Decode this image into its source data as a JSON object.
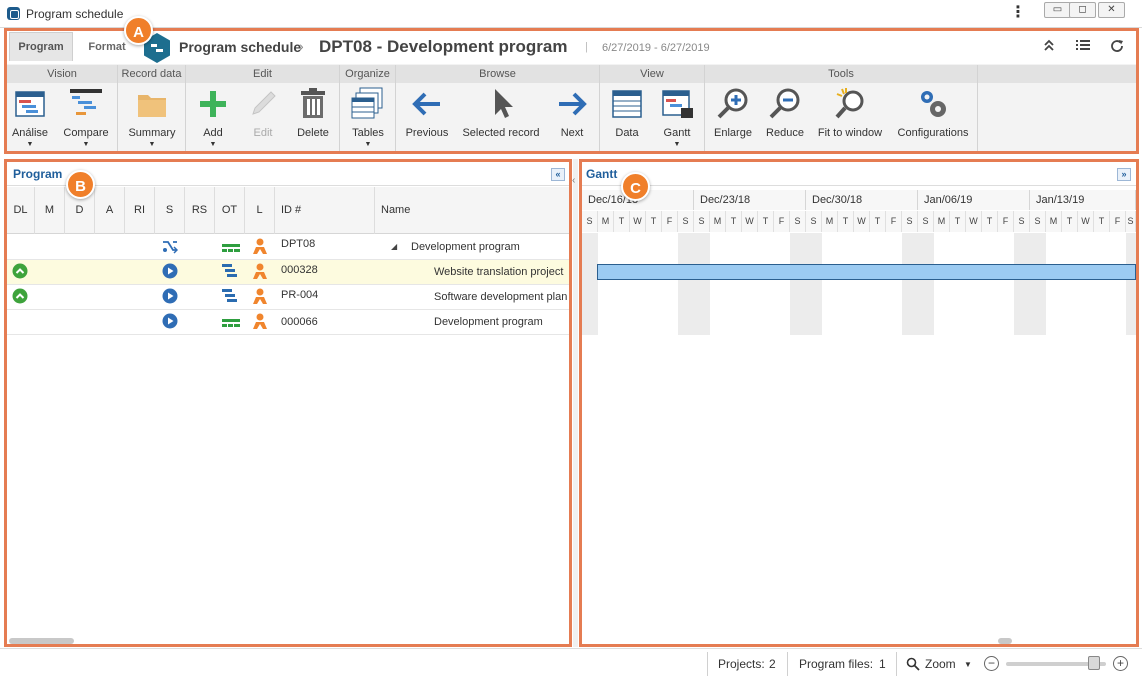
{
  "window": {
    "title": "Program schedule",
    "menu_icon": "kebab-icon",
    "controls": [
      "minimize-icon",
      "restore-icon",
      "close-icon"
    ]
  },
  "tabs": [
    {
      "label": "Program",
      "active": true
    },
    {
      "label": "Format",
      "active": false
    }
  ],
  "header": {
    "breadcrumb": "Program schedule",
    "separator": "›",
    "record_title": "DPT08 - Development program",
    "divider": "|",
    "date_range": "6/27/2019 - 6/27/2019",
    "icons": [
      "collapse-up-icon",
      "list-icon",
      "refresh-icon"
    ]
  },
  "ribbon": {
    "groups": {
      "vision": "Vision",
      "record_data": "Record data",
      "edit": "Edit",
      "organize": "Organize",
      "browse": "Browse",
      "view": "View",
      "tools": "Tools"
    },
    "buttons": {
      "analise": "Análise",
      "compare": "Compare",
      "summary": "Summary",
      "add": "Add",
      "edit": "Edit",
      "delete": "Delete",
      "tables": "Tables",
      "previous": "Previous",
      "selected_record": "Selected record",
      "next": "Next",
      "data": "Data",
      "gantt": "Gantt",
      "enlarge": "Enlarge",
      "reduce": "Reduce",
      "fit_to_window": "Fit to window",
      "configurations": "Configurations"
    }
  },
  "program_panel": {
    "title": "Program",
    "columns": [
      "DL",
      "M",
      "D",
      "A",
      "RI",
      "S",
      "RS",
      "OT",
      "L",
      "ID #",
      "Name"
    ],
    "rows": [
      {
        "dl": "",
        "s_icon": "shuffle-icon",
        "ot_color": "#2e9e3f",
        "id": "DPT08",
        "name": "Development program",
        "expand": "◢",
        "selected": false
      },
      {
        "dl": "up-circle-icon",
        "s_icon": "play-circle-icon",
        "ot_color": "#2b6cb0",
        "id": "000328",
        "name": "Website translation project",
        "selected": true
      },
      {
        "dl": "up-circle-icon",
        "s_icon": "play-circle-icon",
        "ot_color": "#2b6cb0",
        "id": "PR-004",
        "name": "Software development plan",
        "selected": false
      },
      {
        "dl": "",
        "s_icon": "play-circle-icon",
        "ot_color": "#2e9e3f",
        "id": "000066",
        "name": "Development program",
        "selected": false
      }
    ]
  },
  "gantt_panel": {
    "title": "Gantt",
    "weeks": [
      "Dec/16/18",
      "Dec/23/18",
      "Dec/30/18",
      "Jan/06/19",
      "Jan/13/19"
    ],
    "day_letters": [
      "S",
      "M",
      "T",
      "W",
      "T",
      "F",
      "S"
    ],
    "bar_color": "#9ccbf2"
  },
  "statusbar": {
    "projects_label": "Projects:",
    "projects_count": "2",
    "program_files_label": "Program files:",
    "program_files_count": "1",
    "zoom_label": "Zoom",
    "zoom_level": 0.88
  },
  "callouts": {
    "a": "A",
    "b": "B",
    "c": "C"
  },
  "colors": {
    "accent": "#e57c52",
    "badge": "#f07f2a",
    "panel_title": "#1f5e9b"
  }
}
